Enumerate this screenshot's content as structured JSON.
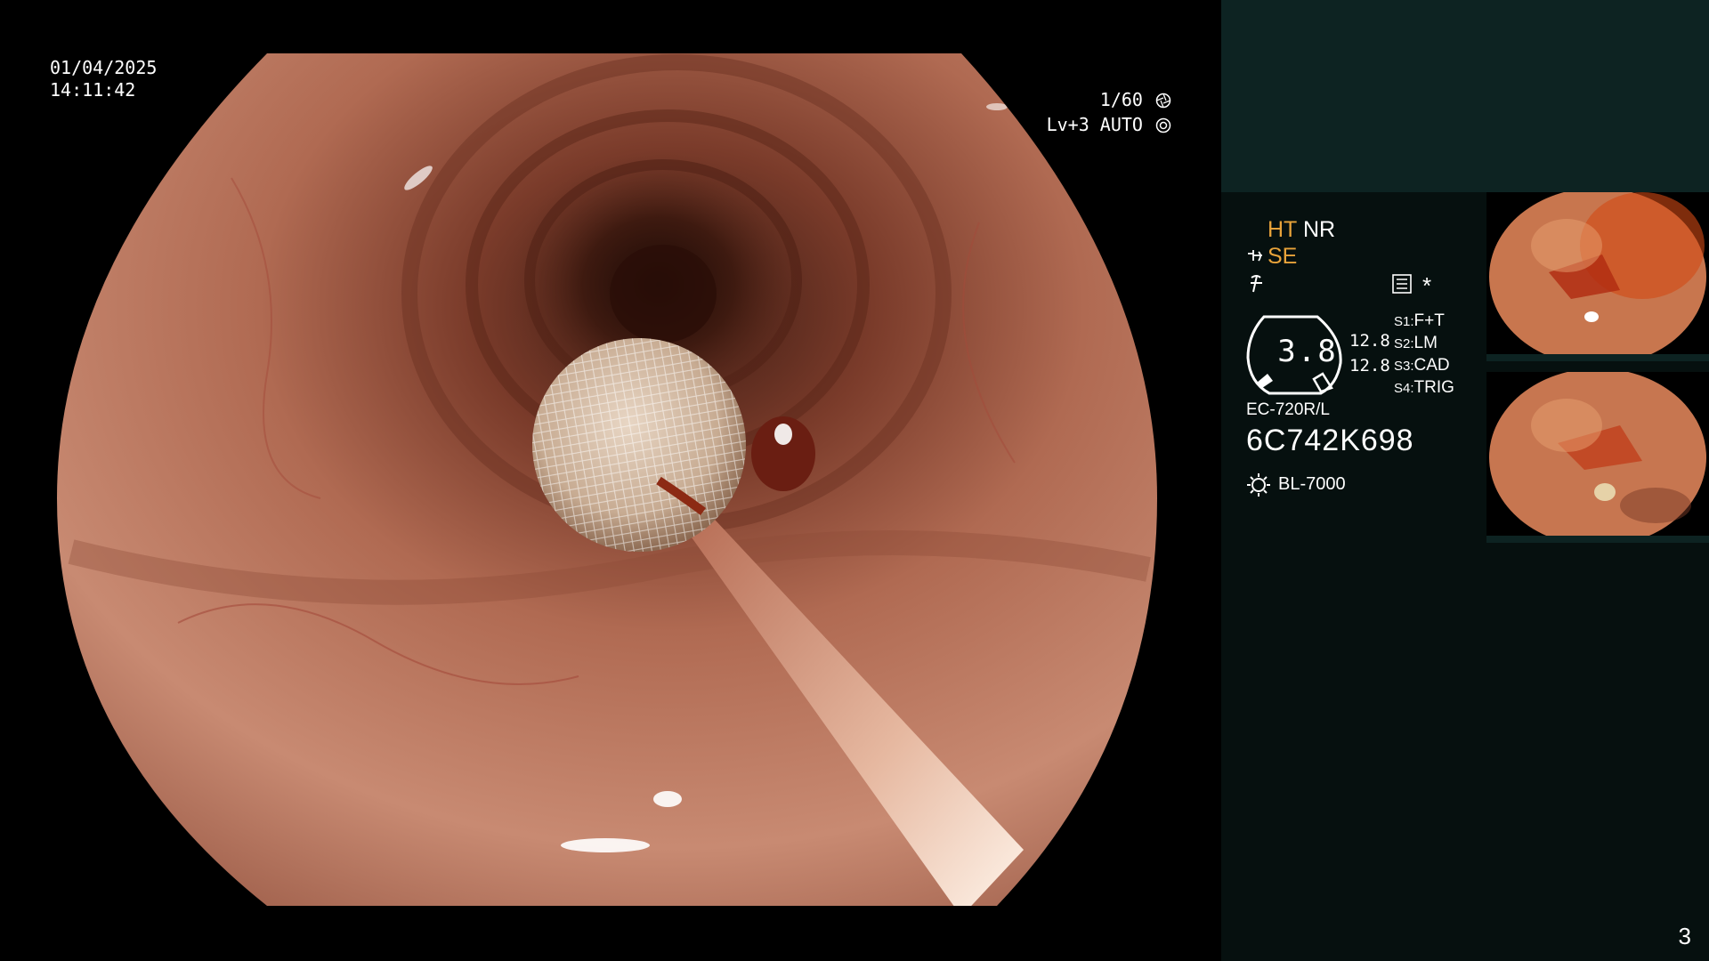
{
  "overlay": {
    "date": "01/04/2025",
    "time": "14:11:42",
    "shutter": "1/60",
    "level": "Lv+3 AUTO",
    "shutter_icon": "aperture-icon",
    "level_icon": "iris-icon"
  },
  "panel": {
    "ht": "HT",
    "nr": "NR",
    "se": "SE",
    "asterisk": "*",
    "gauge_value": "3.8",
    "gauge_sub_a": "12.8",
    "gauge_sub_b": "12.8",
    "switches": [
      {
        "key": "S1:",
        "value": "F+T"
      },
      {
        "key": "S2:",
        "value": "LM"
      },
      {
        "key": "S3:",
        "value": "CAD"
      },
      {
        "key": "S4:",
        "value": "TRIG"
      }
    ],
    "scope_model": "EC-720R/L",
    "scope_serial": "6C742K698",
    "light_source": "BL-7000"
  },
  "page_number": "3",
  "colors": {
    "accent_orange": "#e8a33a",
    "panel_top": "#0d2322",
    "panel_bg": "#06100f",
    "mucosa": "#c47a60"
  }
}
